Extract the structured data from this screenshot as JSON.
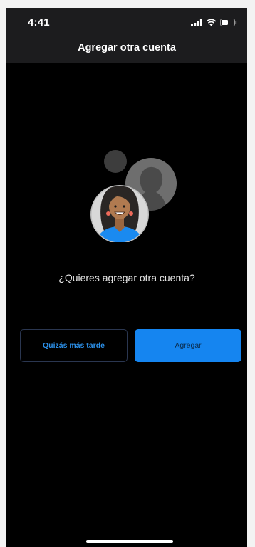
{
  "status_bar": {
    "time": "4:41",
    "icons": [
      "cellular-signal-icon",
      "wifi-icon",
      "battery-icon"
    ]
  },
  "header": {
    "title": "Agregar otra cuenta"
  },
  "main": {
    "illustration": [
      "avatar-illustration-icon"
    ],
    "question": "¿Quieres agregar otra cuenta?",
    "secondary_button": "Quizás más tarde",
    "primary_button": "Agregar"
  },
  "colors": {
    "background": "#000000",
    "bar": "#1c1c1e",
    "accent": "#1585f0",
    "secondary_text": "#2b8fe8"
  }
}
